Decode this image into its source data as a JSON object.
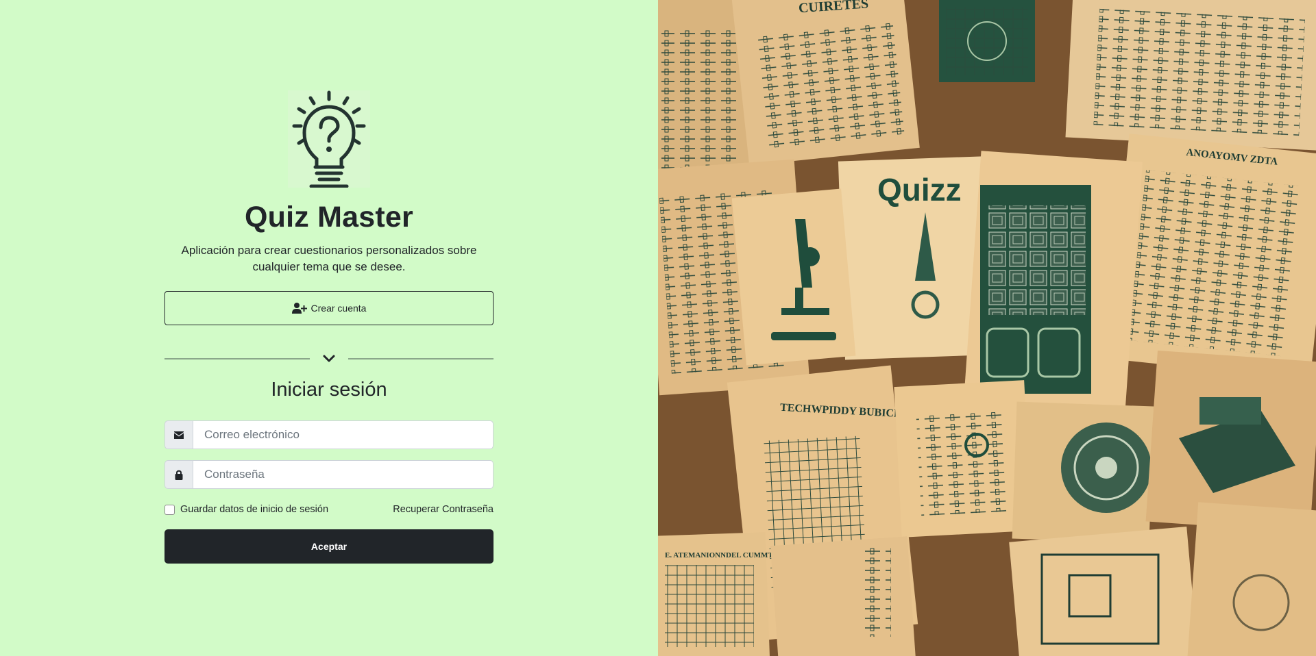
{
  "app": {
    "title": "Quiz Master",
    "description": "Aplicación para crear cuestionarios personalizados sobre cualquier tema que se desee.",
    "logo_icon": "lightbulb-question-icon"
  },
  "signup": {
    "label": "Crear cuenta",
    "icon": "user-plus-icon"
  },
  "divider": {
    "icon": "chevron-down-icon"
  },
  "login": {
    "title": "Iniciar sesión",
    "email_placeholder": "Correo electrónico",
    "email_icon": "envelope-icon",
    "password_placeholder": "Contraseña",
    "password_icon": "lock-icon",
    "remember_label": "Guardar datos de inicio de sesión",
    "remember_checked": false,
    "recover_label": "Recuperar Contraseña",
    "submit_label": "Aceptar"
  },
  "artwork": {
    "texts": [
      "CUIRETES",
      "Quizz",
      "ANOAYOMV ZDTA",
      "TECHWPIDDY BUBICLE",
      "E. ATEMANIONNDEL CUMMTIUFE."
    ]
  },
  "colors": {
    "left_bg": "#d2fbc8",
    "dark": "#212529",
    "paper": "#e8c48e",
    "ink": "#1f4d3c"
  }
}
